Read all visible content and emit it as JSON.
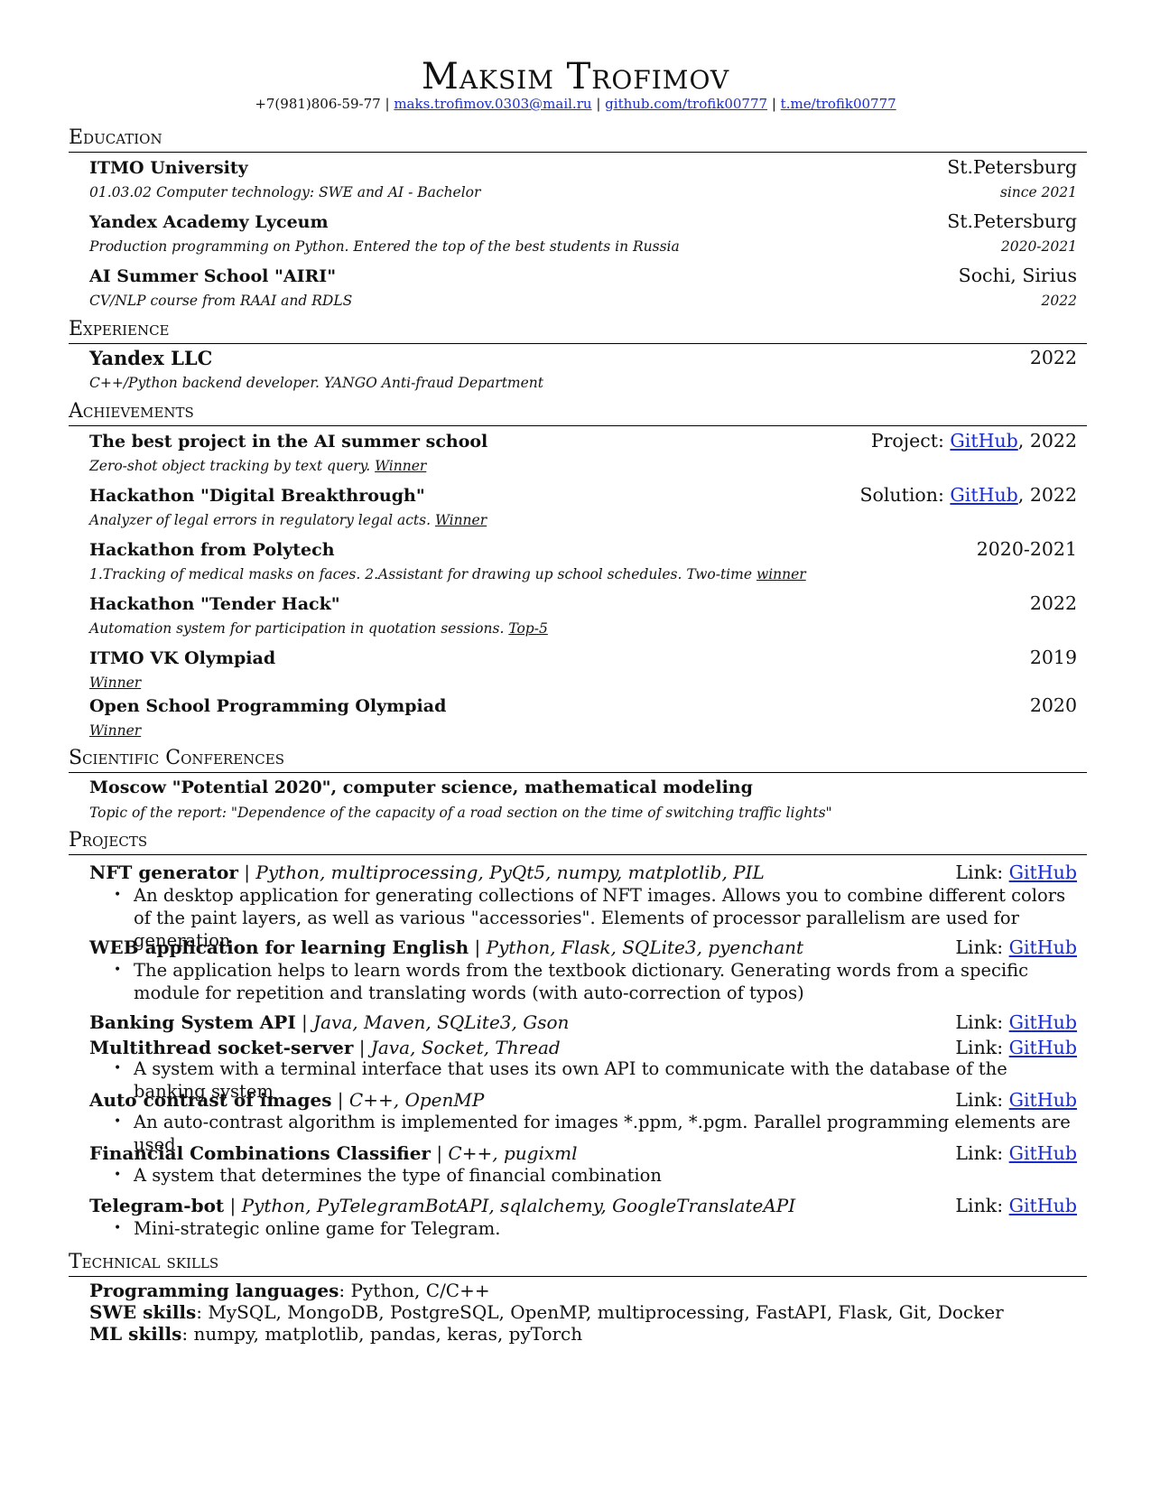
{
  "header": {
    "name": "Maksim Trofimov",
    "phone": "+7(981)806-59-77",
    "separator": "|",
    "email": "maks.trofimov.0303@mail.ru",
    "github": "github.com/trofik00777",
    "telegram": "t.me/trofik00777"
  },
  "sections": {
    "education": "Education",
    "experience": "Experience",
    "achievements": "Achievements",
    "conferences": "Scientific Conferences",
    "projects": "Projects",
    "skills": "Technical skills"
  },
  "education": [
    {
      "title": "ITMO University",
      "place": "St.Petersburg",
      "desc": "01.03.02 Computer technology: SWE and AI - Bachelor",
      "date": "since 2021"
    },
    {
      "title": "Yandex Academy Lyceum",
      "place": "St.Petersburg",
      "desc": "Production programming on Python. Entered the top of the best students in Russia",
      "date": "2020-2021"
    },
    {
      "title": "AI Summer School \"AIRI\"",
      "place": "Sochi, Sirius",
      "desc": "CV/NLP course from RAAI and RDLS",
      "date": "2022"
    }
  ],
  "experience": [
    {
      "title": "Yandex LLC",
      "date": "2022",
      "desc": "C++/Python backend developer. YANGO Anti-fraud Department"
    }
  ],
  "achievements": [
    {
      "title": "The best project in the AI summer school",
      "right_prefix": "Project: ",
      "right_link": "GitHub",
      "right_suffix": ", 2022",
      "desc": "Zero-shot object tracking by text query.",
      "result": "Winner"
    },
    {
      "title": "Hackathon \"Digital Breakthrough\"",
      "right_prefix": "Solution: ",
      "right_link": "GitHub",
      "right_suffix": ", 2022",
      "desc": "Analyzer of legal errors in regulatory legal acts.",
      "result": "Winner"
    },
    {
      "title": "Hackathon from Polytech",
      "date": "2020-2021",
      "desc": "1.Tracking of medical masks on faces. 2.Assistant for drawing up school schedules. Two-time",
      "result": "winner"
    },
    {
      "title": "Hackathon \"Tender Hack\"",
      "date": "2022",
      "desc": "Automation system for participation in quotation sessions.",
      "result": "Top-5"
    },
    {
      "title": "ITMO VK Olympiad",
      "date": "2019",
      "result": "Winner"
    },
    {
      "title": "Open School Programming Olympiad",
      "date": "2020",
      "result": "Winner"
    }
  ],
  "conferences": [
    {
      "title": "Moscow \"Potential 2020\", computer science, mathematical modeling",
      "desc": "Topic of the report: \"Dependence of the capacity of a road section on the time of switching traffic lights\""
    }
  ],
  "projects": {
    "link_label": "Link: ",
    "link_text": "GitHub",
    "bullet": "•",
    "items": [
      {
        "name": "NFT generator",
        "tech": "Python, multiprocessing, PyQt5, numpy, matplotlib, PIL",
        "bullet_text": "An desktop application for generating collections of NFT images. Allows you to combine different colors of the paint layers, as well as various \"accessories\". Elements of processor parallelism are used for generation"
      },
      {
        "name": "WEB application for learning English",
        "tech": "Python, Flask, SQLite3, pyenchant",
        "bullet_text": "The application helps to learn words from the textbook dictionary. Generating words from a specific module for repetition and translating words (with auto-correction of typos)"
      },
      {
        "name": "Banking System API",
        "tech": "Java, Maven, SQLite3, Gson"
      },
      {
        "name": "Multithread socket-server",
        "tech": "Java, Socket, Thread",
        "bullet_text": "A system with a terminal interface that uses its own API to communicate with the database of the banking system"
      },
      {
        "name": "Auto contrast of images",
        "tech": "C++, OpenMP",
        "bullet_text": "An auto-contrast algorithm is implemented for images *.ppm, *.pgm. Parallel programming elements are used"
      },
      {
        "name": "Financial Combinations Classifier",
        "tech": "C++, pugixml",
        "bullet_text": "A system that determines the type of financial combination"
      },
      {
        "name": "Telegram-bot",
        "tech": "Python, PyTelegramBotAPI, sqlalchemy, GoogleTranslateAPI",
        "bullet_text": "Mini-strategic online game for Telegram."
      }
    ]
  },
  "skills": [
    {
      "label": "Programming languages",
      "value": ": Python, C/C++"
    },
    {
      "label": "SWE skills",
      "value": ": MySQL, MongoDB, PostgreSQL, OpenMP, multiprocessing, FastAPI, Flask, Git, Docker"
    },
    {
      "label": "ML skills",
      "value": ": numpy, matplotlib, pandas, keras, pyTorch"
    }
  ]
}
